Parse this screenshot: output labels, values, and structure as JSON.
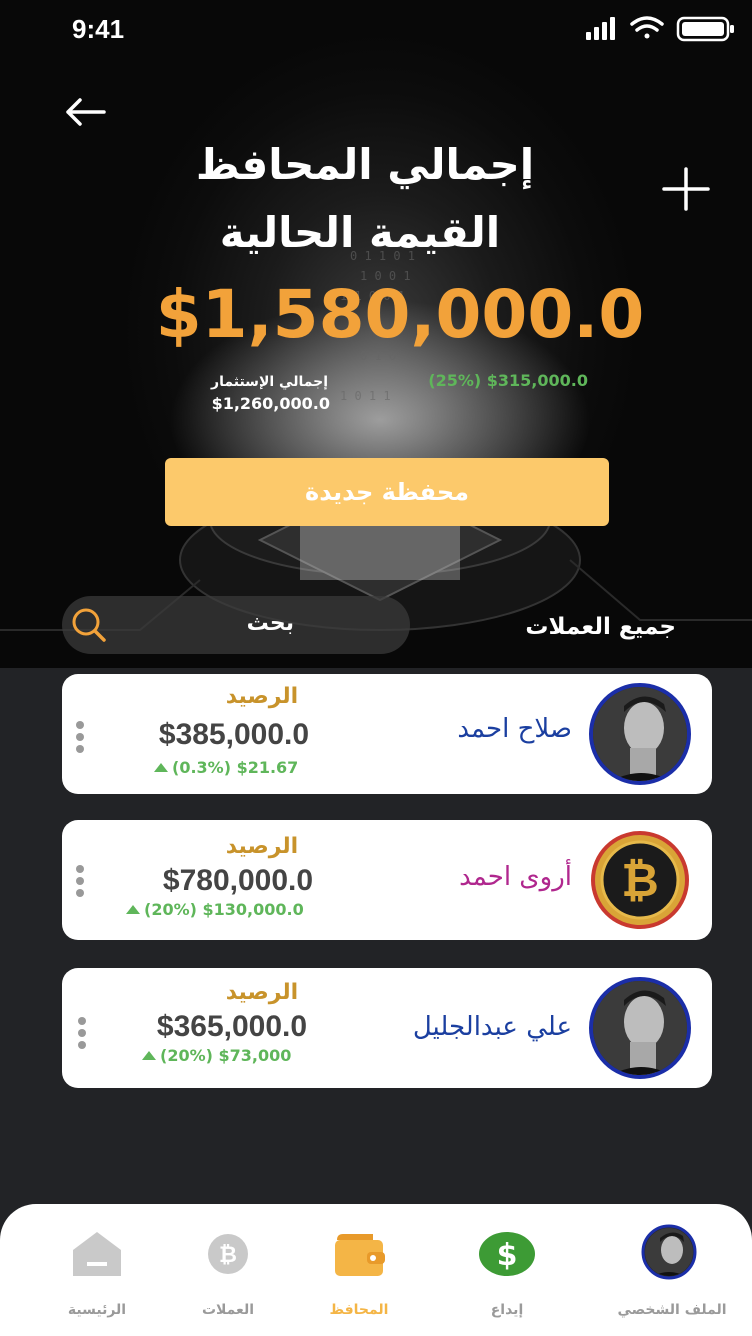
{
  "status_bar": {
    "time": "9:41"
  },
  "header": {
    "title_line1": "إجمالي المحافظ",
    "title_line2": "القيمة الحالية",
    "total_value": "$1,580,000.0",
    "investment_label": "إجمالي الإستثمار",
    "investment_value": "$1,260,000.0",
    "profit": "(25%) $315,000.0",
    "new_wallet_button": "محفظة جديدة"
  },
  "filters": {
    "search_label": "بحث",
    "all_coins_label": "جميع العملات"
  },
  "wallets": [
    {
      "owner": "صلاح احمد",
      "balance_label": "الرصيد",
      "balance": "$385,000.0",
      "change": "(0.3%) $21.67",
      "owner_color": "#1b3fa0",
      "avatar_icon": "person-avatar"
    },
    {
      "owner": "أروى احمد",
      "balance_label": "الرصيد",
      "balance": "$780,000.0",
      "change": "(20%) $130,000.0",
      "owner_color": "#b0278e",
      "avatar_icon": "bitcoin-coin-avatar"
    },
    {
      "owner": "علي عبدالجليل",
      "balance_label": "الرصيد",
      "balance": "$365,000.0",
      "change": "(20%) $73,000",
      "owner_color": "#1b3fa0",
      "avatar_icon": "person-avatar"
    }
  ],
  "bottom_nav": {
    "items": [
      {
        "label": "الرئيسية",
        "icon": "home-icon",
        "active": false
      },
      {
        "label": "العملات",
        "icon": "coin-icon",
        "active": false
      },
      {
        "label": "المحافظ",
        "icon": "wallet-icon",
        "active": true
      },
      {
        "label": "إيداع",
        "icon": "dollar-icon",
        "active": false
      },
      {
        "label": "الملف الشخصي",
        "icon": "profile-avatar-icon",
        "active": false
      }
    ]
  },
  "colors": {
    "accent": "#f2a23a",
    "button": "#fcc96b",
    "positive": "#5fb65a",
    "balance_label": "#c8932b"
  }
}
